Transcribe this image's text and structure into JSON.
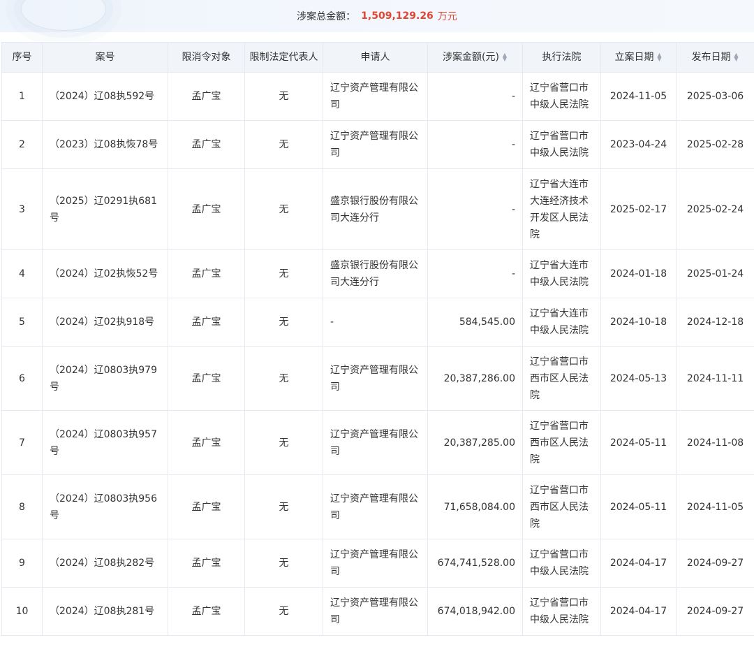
{
  "summary": {
    "label": "涉案总金额：",
    "amount": "1,509,129.26",
    "unit": "万元"
  },
  "colors": {
    "link": "#3a8ee6",
    "amount": "#e0452f",
    "header_bg": "#f1f5fa"
  },
  "columns": {
    "idx": "序号",
    "case_no": "案号",
    "target": "限消令对象",
    "legal_rep": "限制法定代表人",
    "applicant": "申请人",
    "amount": "涉案金额(元)",
    "court": "执行法院",
    "filed": "立案日期",
    "published": "发布日期"
  },
  "rows": [
    {
      "idx": "1",
      "case_no": "（2024）辽08执592号",
      "target": "孟广宝",
      "legal_rep": "无",
      "applicant": "辽宁资产管理有限公司",
      "amount": "-",
      "court": "辽宁省营口市中级人民法院",
      "filed": "2024-11-05",
      "published": "2025-03-06"
    },
    {
      "idx": "2",
      "case_no": "（2023）辽08执恢78号",
      "target": "孟广宝",
      "legal_rep": "无",
      "applicant": "辽宁资产管理有限公司",
      "amount": "-",
      "court": "辽宁省营口市中级人民法院",
      "filed": "2023-04-24",
      "published": "2025-02-28"
    },
    {
      "idx": "3",
      "case_no": "（2025）辽0291执681号",
      "target": "孟广宝",
      "legal_rep": "无",
      "applicant": "盛京银行股份有限公司大连分行",
      "amount": "-",
      "court": "辽宁省大连市大连经济技术开发区人民法院",
      "filed": "2025-02-17",
      "published": "2025-02-24"
    },
    {
      "idx": "4",
      "case_no": "（2024）辽02执恢52号",
      "target": "孟广宝",
      "legal_rep": "无",
      "applicant": "盛京银行股份有限公司大连分行",
      "amount": "-",
      "court": "辽宁省大连市中级人民法院",
      "filed": "2024-01-18",
      "published": "2025-01-24"
    },
    {
      "idx": "5",
      "case_no": "（2024）辽02执918号",
      "target": "孟广宝",
      "legal_rep": "无",
      "applicant": "-",
      "amount": "584,545.00",
      "court": "辽宁省大连市中级人民法院",
      "filed": "2024-10-18",
      "published": "2024-12-18"
    },
    {
      "idx": "6",
      "case_no": "（2024）辽0803执979号",
      "target": "孟广宝",
      "legal_rep": "无",
      "applicant": "辽宁资产管理有限公司",
      "amount": "20,387,286.00",
      "court": "辽宁省营口市西市区人民法院",
      "filed": "2024-05-13",
      "published": "2024-11-11"
    },
    {
      "idx": "7",
      "case_no": "（2024）辽0803执957号",
      "target": "孟广宝",
      "legal_rep": "无",
      "applicant": "辽宁资产管理有限公司",
      "amount": "20,387,285.00",
      "court": "辽宁省营口市西市区人民法院",
      "filed": "2024-05-11",
      "published": "2024-11-08"
    },
    {
      "idx": "8",
      "case_no": "（2024）辽0803执956号",
      "target": "孟广宝",
      "legal_rep": "无",
      "applicant": "辽宁资产管理有限公司",
      "amount": "71,658,084.00",
      "court": "辽宁省营口市西市区人民法院",
      "filed": "2024-05-11",
      "published": "2024-11-05"
    },
    {
      "idx": "9",
      "case_no": "（2024）辽08执282号",
      "target": "孟广宝",
      "legal_rep": "无",
      "applicant": "辽宁资产管理有限公司",
      "amount": "674,741,528.00",
      "court": "辽宁省营口市中级人民法院",
      "filed": "2024-04-17",
      "published": "2024-09-27"
    },
    {
      "idx": "10",
      "case_no": "（2024）辽08执281号",
      "target": "孟广宝",
      "legal_rep": "无",
      "applicant": "辽宁资产管理有限公司",
      "amount": "674,018,942.00",
      "court": "辽宁省营口市中级人民法院",
      "filed": "2024-04-17",
      "published": "2024-09-27"
    }
  ]
}
